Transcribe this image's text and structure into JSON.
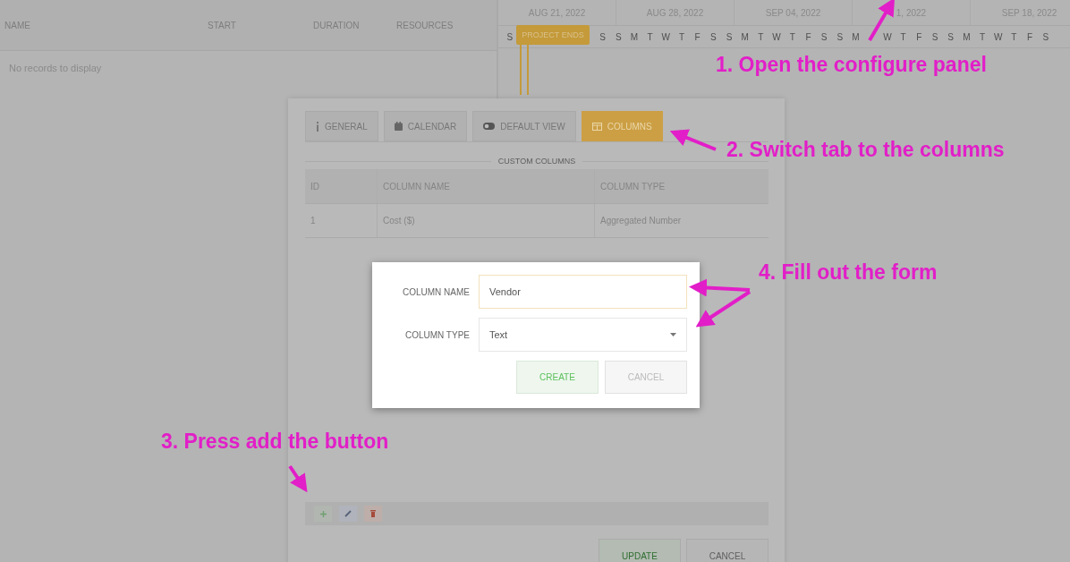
{
  "grid": {
    "columns": [
      "NAME",
      "START",
      "DURATION",
      "RESOURCES"
    ],
    "empty_text": "No records to display"
  },
  "timeline": {
    "weeks": [
      "AUG 21, 2022",
      "AUG 28, 2022",
      "SEP 04, 2022",
      "1, 2022",
      "SEP 18, 2022"
    ],
    "days": [
      "S",
      "S",
      "S",
      "M",
      "T",
      "W",
      "T",
      "F",
      "S",
      "S",
      "M",
      "T",
      "W",
      "T",
      "F",
      "S",
      "S",
      "M",
      "W",
      "T",
      "F",
      "S",
      "S",
      "M",
      "T",
      "W",
      "T",
      "F",
      "S"
    ],
    "task": {
      "label": "PROJECT ENDS"
    }
  },
  "configure_dialog": {
    "tabs": [
      {
        "label": "GENERAL",
        "selected": false
      },
      {
        "label": "CALENDAR",
        "selected": false
      },
      {
        "label": "DEFAULT VIEW",
        "selected": false
      },
      {
        "label": "COLUMNS",
        "selected": true
      }
    ],
    "section_title": "CUSTOM COLUMNS",
    "table": {
      "columns": [
        "ID",
        "COLUMN NAME",
        "COLUMN TYPE"
      ],
      "rows": [
        [
          "1",
          "Cost ($)",
          "Aggregated Number"
        ]
      ]
    },
    "buttons": [
      "UPDATE",
      "CANCEL"
    ]
  },
  "create_dialog": {
    "fields": [
      {
        "label": "COLUMN NAME",
        "kind": "text",
        "value": "Vendor"
      },
      {
        "label": "COLUMN TYPE",
        "kind": "select",
        "value": "Text"
      }
    ],
    "buttons": [
      "CREATE",
      "CANCEL"
    ]
  },
  "annotations": [
    "1. Open the configure panel",
    "2. Switch tab to the columns",
    "3. Press add the button",
    "4. Fill out the form"
  ]
}
